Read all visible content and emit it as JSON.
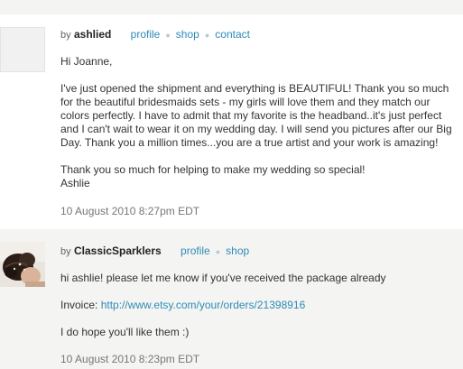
{
  "messages": [
    {
      "by_label": "by",
      "author": "ashlied",
      "links": [
        "profile",
        "shop",
        "contact"
      ],
      "greeting": "Hi Joanne,",
      "paragraph": "I've just opened the shipment and everything is BEAUTIFUL! Thank you so much for the beautiful bridesmaids sets - my girls will love them and they match our colors perfectly. I have to admit that my favorite is the headband..it's just perfect and I can't wait to wear it on my wedding day. I will send you pictures after our Big Day. Thank you a million times...you are a true artist and your work is amazing!",
      "closing_line1": "Thank you so much for helping to make my wedding so special!",
      "closing_line2": "Ashlie",
      "timestamp": "10 August 2010 8:27pm EDT"
    },
    {
      "by_label": "by",
      "author": "ClassicSparklers",
      "links": [
        "profile",
        "shop"
      ],
      "line1": "hi ashlie! please let me know if you've received the package already",
      "invoice_label": "Invoice:",
      "invoice_url": "http://www.etsy.com/your/orders/21398916",
      "line3": "I do hope you'll like them :)",
      "timestamp": "10 August 2010 8:23pm EDT"
    }
  ],
  "colors": {
    "link": "#2f8bb8",
    "message_bg_white": "#ffffff",
    "message_bg_grey": "#f4f4f2"
  },
  "icons": {
    "separator": "bullet-icon",
    "avatar1": "blank-avatar",
    "avatar2": "hair-bun-photo-avatar"
  }
}
